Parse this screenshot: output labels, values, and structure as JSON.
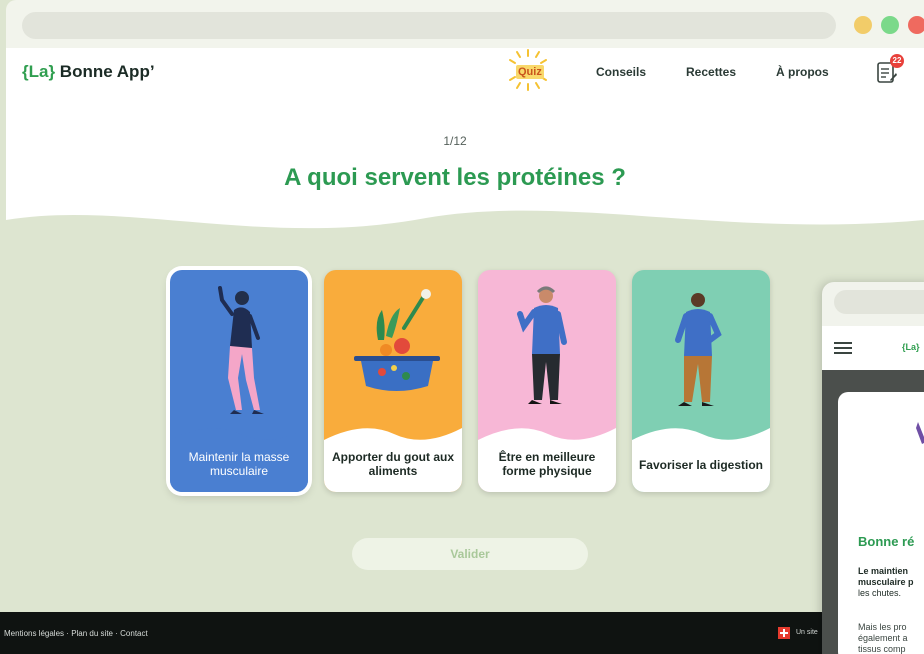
{
  "browser": {
    "window_controls": [
      "yellow-dot",
      "green-dot",
      "red-dot"
    ]
  },
  "header": {
    "logo_open": "{La}",
    "logo_text": " Bonne App’",
    "nav": {
      "quiz": "Quiz",
      "conseils": "Conseils",
      "recettes": "Recettes",
      "a_propos": "À propos"
    },
    "notes_badge": "22"
  },
  "quiz": {
    "counter": "1/12",
    "question": "A quoi servent les protéines ?",
    "options": [
      {
        "label": "Maintenir la masse musculaire",
        "color": "#4a7fd1",
        "selected": true
      },
      {
        "label": "Apporter du gout aux aliments",
        "color": "#f9ac3c",
        "selected": false
      },
      {
        "label": "Être en meilleure forme physique",
        "color": "#f7b7d6",
        "selected": false
      },
      {
        "label": "Favoriser la digestion",
        "color": "#7fcfb3",
        "selected": false
      }
    ],
    "submit_label": "Valider"
  },
  "footer": {
    "mentions": "Mentions légales",
    "plan": "Plan du site",
    "contact": "Contact",
    "separator": "·",
    "right_text": "Un site"
  },
  "mobile": {
    "logo": "{La}",
    "answer_title": "Bonne ré",
    "answer_text_bold_1": "Le maintien",
    "answer_text_bold_2": "musculaire p",
    "answer_text_3": "les chutes.",
    "answer_text_4": "Mais les pro",
    "answer_text_5": "également a",
    "answer_text_6": "tissus comp"
  },
  "colors": {
    "accent_green": "#2c9a52",
    "background_green": "#dde5d0",
    "footer": "#0f1311"
  }
}
